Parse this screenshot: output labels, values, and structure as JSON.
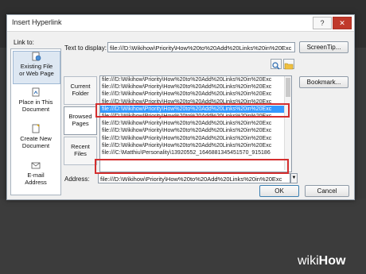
{
  "dialog": {
    "title": "Insert Hyperlink",
    "help_glyph": "?",
    "close_glyph": "✕"
  },
  "link_to": {
    "label": "Link to:",
    "items": [
      {
        "line1": "Existing File",
        "line2": "or Web Page"
      },
      {
        "line1": "Place in This",
        "line2": "Document"
      },
      {
        "line1": "Create New",
        "line2": "Document"
      },
      {
        "line1": "E-mail",
        "line2": "Address"
      }
    ]
  },
  "text_to_display": {
    "label": "Text to display:",
    "value": "file:///D:\\Wikihow\\Priority\\How%20to%20Add%20Links%20in%20Exc"
  },
  "buttons": {
    "screentip": "ScreenTip...",
    "bookmark": "Bookmark...",
    "ok": "OK",
    "cancel": "Cancel"
  },
  "look_in": {
    "current_folder": {
      "line1": "Current",
      "line2": "Folder"
    },
    "browsed_pages": {
      "line1": "Browsed",
      "line2": "Pages"
    },
    "recent_files": {
      "line1": "Recent",
      "line2": "Files"
    }
  },
  "file_list": [
    "file:///D:\\Wikihow\\Priority\\How%20to%20Add%20Links%20in%20Exc",
    "file:///D:\\Wikihow\\Priority\\How%20to%20Add%20Links%20in%20Exc",
    "file:///D:\\Wikihow\\Priority\\How%20to%20Add%20Links%20in%20Exc",
    "file:///D:\\Wikihow\\Priority\\How%20to%20Add%20Links%20in%20Exc",
    "file:///D:\\Wikihow\\Priority\\How%20to%20Add%20Links%20in%20Exc",
    "file:///D:\\Wikihow\\Priority\\How%20to%20Add%20Links%20in%20Exc",
    "file:///D:\\Wikihow\\Priority\\How%20to%20Add%20Links%20in%20Exc",
    "file:///D:\\Wikihow\\Priority\\How%20to%20Add%20Links%20in%20Exc",
    "file:///D:\\Wikihow\\Priority\\How%20to%20Add%20Links%20in%20Exc",
    "file:///D:\\Wikihow\\Priority\\How%20to%20Add%20Links%20in%20Exc",
    "file:///C:\\Matthiu\\Personality\\13920552_1646881345451570_915186"
  ],
  "address": {
    "label": "Address:",
    "value": "file:///D:\\Wikihow\\Priority\\How%20to%20Add%20Links%20in%20Exc"
  },
  "watermark": {
    "bold": "wiki",
    "rest": "How"
  },
  "colors": {
    "selection": "#3399ff",
    "highlight_box": "#d42e2e"
  }
}
